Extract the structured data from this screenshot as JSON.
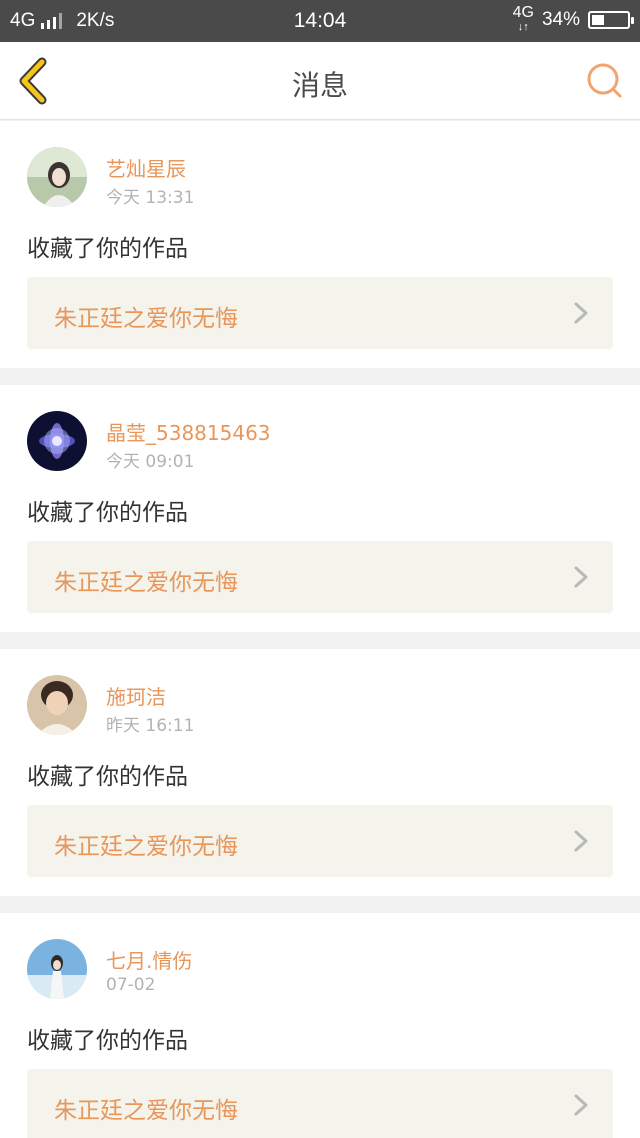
{
  "status_bar": {
    "network_left": "4G",
    "speed": "2K/s",
    "time": "14:04",
    "network_right": "4G",
    "battery": "34%",
    "battery_level": 0.34
  },
  "header": {
    "title": "消息",
    "back_icon": "chevron-left-icon",
    "search_icon": "search-icon",
    "accent_color": "#f5c518",
    "search_color": "#f0a570"
  },
  "messages": [
    {
      "username": "艺灿星辰",
      "time": "今天 13:31",
      "action": "收藏了你的作品",
      "work_title": "朱正廷之爱你无悔"
    },
    {
      "username": "晶莹_538815463",
      "time": "今天 09:01",
      "action": "收藏了你的作品",
      "work_title": "朱正廷之爱你无悔"
    },
    {
      "username": "施珂洁",
      "time": "昨天 16:11",
      "action": "收藏了你的作品",
      "work_title": "朱正廷之爱你无悔"
    },
    {
      "username": "七月.情伤",
      "time": "07-02",
      "action": "收藏了你的作品",
      "work_title": "朱正廷之爱你无悔"
    }
  ],
  "colors": {
    "username": "#e8965a",
    "work_title": "#e8965a",
    "link_background": "#f4f4ec",
    "timestamp": "#b3b3b3"
  }
}
